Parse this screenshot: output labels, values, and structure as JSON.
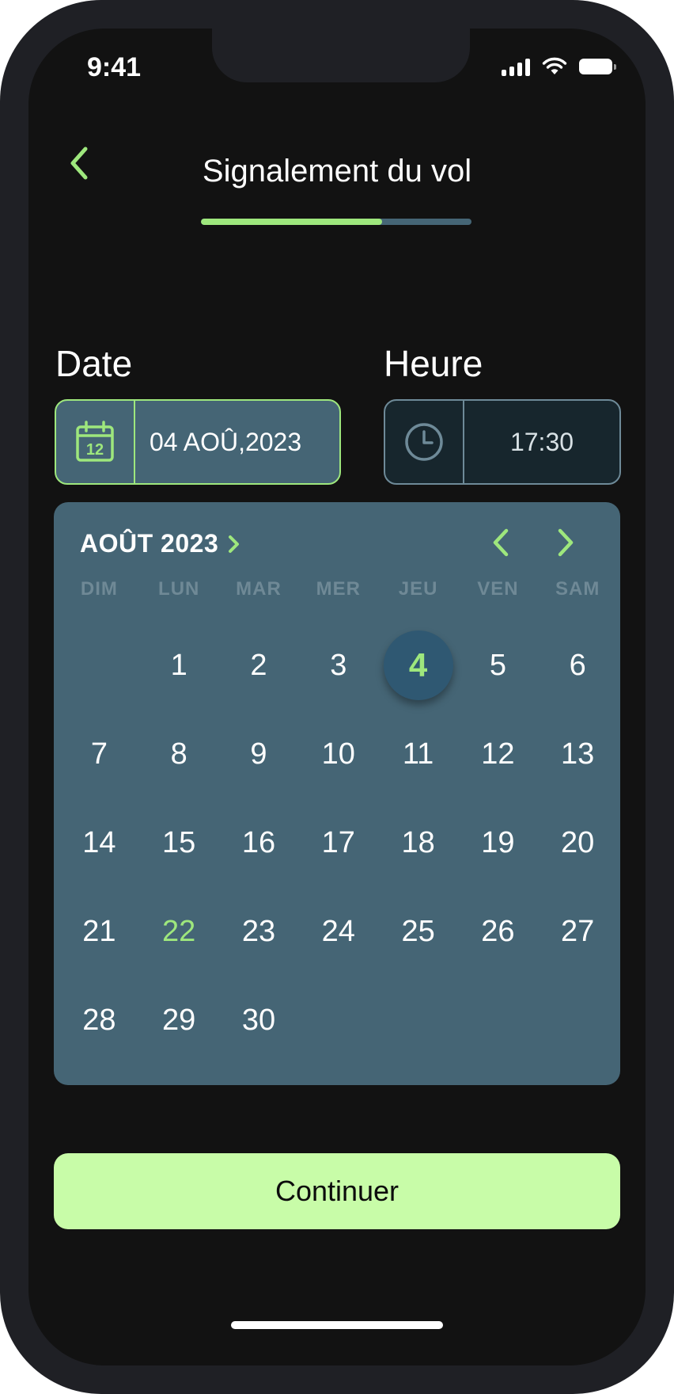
{
  "status_bar": {
    "time": "9:41"
  },
  "header": {
    "title": "Signalement du vol",
    "progress": 0.67
  },
  "form": {
    "date_label": "Date",
    "time_label": "Heure",
    "date_value": "04 AOÛ,2023",
    "time_value": "17:30"
  },
  "calendar": {
    "month_label": "AOÛT 2023",
    "weekdays": [
      "DIM",
      "LUN",
      "MAR",
      "MER",
      "JEU",
      "VEN",
      "SAM"
    ],
    "leading_blanks": 1,
    "days": [
      "1",
      "2",
      "3",
      "4",
      "5",
      "6",
      "7",
      "8",
      "9",
      "10",
      "11",
      "12",
      "13",
      "14",
      "15",
      "16",
      "17",
      "18",
      "19",
      "20",
      "21",
      "22",
      "23",
      "24",
      "25",
      "26",
      "27",
      "28",
      "29",
      "30"
    ],
    "selected_day": "4",
    "today_day": "22"
  },
  "actions": {
    "continue_label": "Continuer"
  },
  "colors": {
    "accent": "#9ee77d",
    "button_bg": "#c8fca8",
    "calendar_bg": "#456575",
    "screen_bg": "#121212"
  },
  "icons": {
    "back": "chevron-left-icon",
    "date": "calendar-icon",
    "time": "clock-icon",
    "month_more": "chevron-right-icon",
    "prev_month": "chevron-left-icon",
    "next_month": "chevron-right-icon"
  }
}
